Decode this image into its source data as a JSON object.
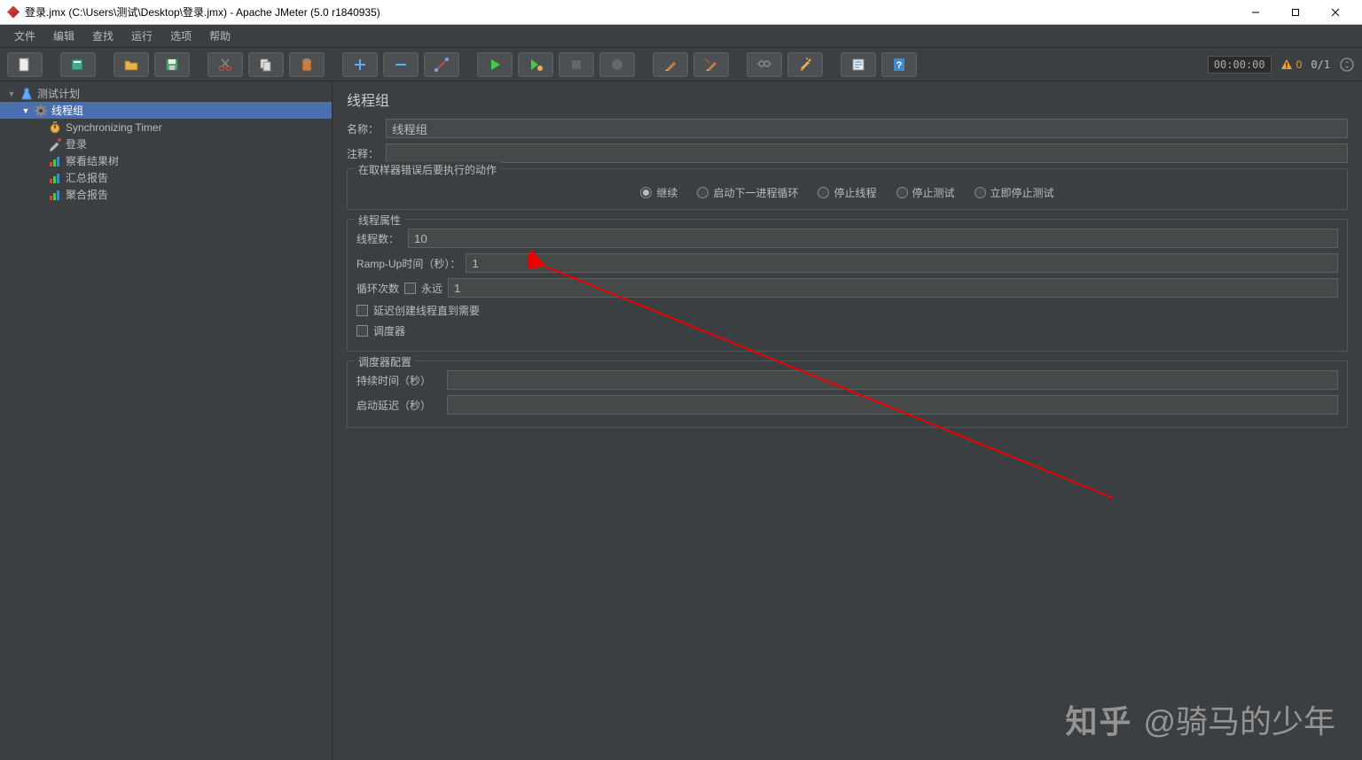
{
  "window": {
    "title": "登录.jmx (C:\\Users\\测试\\Desktop\\登录.jmx) - Apache JMeter (5.0 r1840935)"
  },
  "menu": {
    "items": [
      "文件",
      "编辑",
      "查找",
      "运行",
      "选项",
      "帮助"
    ]
  },
  "toolbar": {
    "timer": "00:00:00",
    "warn_count": "0",
    "thread_count": "0/1"
  },
  "tree": {
    "items": [
      {
        "label": "测试计划",
        "indent": 0,
        "expanded": true,
        "icon": "flask"
      },
      {
        "label": "线程组",
        "indent": 1,
        "expanded": true,
        "icon": "gear",
        "selected": true
      },
      {
        "label": "Synchronizing Timer",
        "indent": 2,
        "icon": "timer"
      },
      {
        "label": "登录",
        "indent": 2,
        "icon": "pipette"
      },
      {
        "label": "察看结果树",
        "indent": 2,
        "icon": "chart"
      },
      {
        "label": "汇总报告",
        "indent": 2,
        "icon": "chart"
      },
      {
        "label": "聚合报告",
        "indent": 2,
        "icon": "chart"
      }
    ]
  },
  "panel": {
    "title": "线程组",
    "name_label": "名称：",
    "name_value": "线程组",
    "comment_label": "注释：",
    "comment_value": "",
    "error_action_legend": "在取样器错误后要执行的动作",
    "error_actions": [
      "继续",
      "启动下一进程循环",
      "停止线程",
      "停止测试",
      "立即停止测试"
    ],
    "error_action_selected": 0,
    "thread_props_legend": "线程属性",
    "threads_label": "线程数：",
    "threads_value": "10",
    "rampup_label": "Ramp-Up时间（秒）：",
    "rampup_value": "1",
    "loop_label": "循环次数",
    "forever_label": "永远",
    "loop_value": "1",
    "delay_create_label": "延迟创建线程直到需要",
    "scheduler_label": "调度器",
    "scheduler_conf_legend": "调度器配置",
    "duration_label": "持续时间（秒）",
    "duration_value": "",
    "startup_delay_label": "启动延迟（秒）",
    "startup_delay_value": ""
  },
  "watermark": {
    "logo": "知乎",
    "text": "@骑马的少年"
  }
}
